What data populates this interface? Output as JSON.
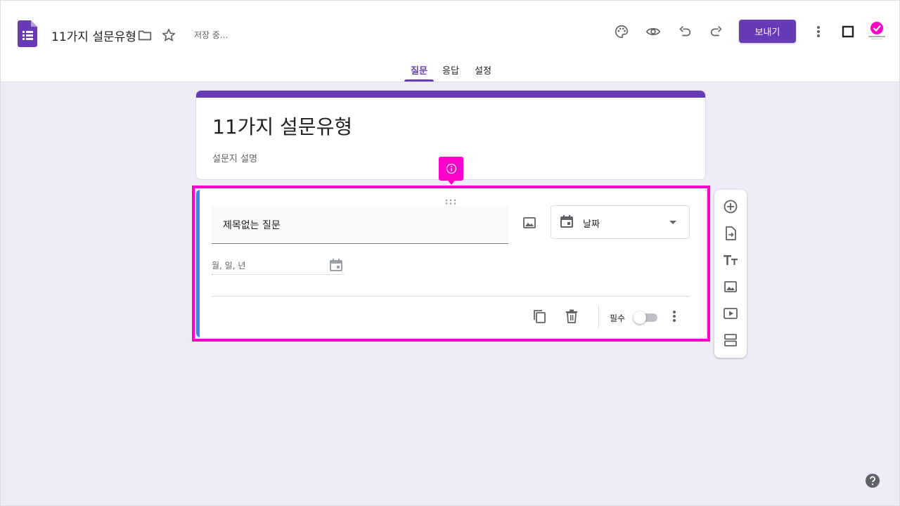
{
  "app": {
    "doc_title": "11가지 설문유형",
    "saving_status": "저장 중...",
    "send_label": "보내기"
  },
  "tabs": [
    {
      "label": "질문",
      "active": true
    },
    {
      "label": "응답",
      "active": false
    },
    {
      "label": "설정",
      "active": false
    }
  ],
  "form": {
    "title": "11가지 설문유형",
    "description": "설문지 설명"
  },
  "question": {
    "title": "제목없는 질문",
    "type_label": "날짜",
    "date_placeholder": "월, 일, 년",
    "required_label": "필수",
    "required": false
  },
  "icons": {
    "toolbar": [
      "folder-icon",
      "star-icon",
      "palette-icon",
      "eye-icon",
      "undo-icon",
      "redo-icon",
      "more-vert-icon",
      "square-icon"
    ],
    "side": [
      "add-circle-icon",
      "import-icon",
      "title-text-icon",
      "image-icon",
      "video-icon",
      "section-icon"
    ]
  },
  "colors": {
    "accent": "#673ab7",
    "background": "#f0ebf8",
    "highlight": "#ff00cc",
    "question_accent": "#4285f4"
  }
}
